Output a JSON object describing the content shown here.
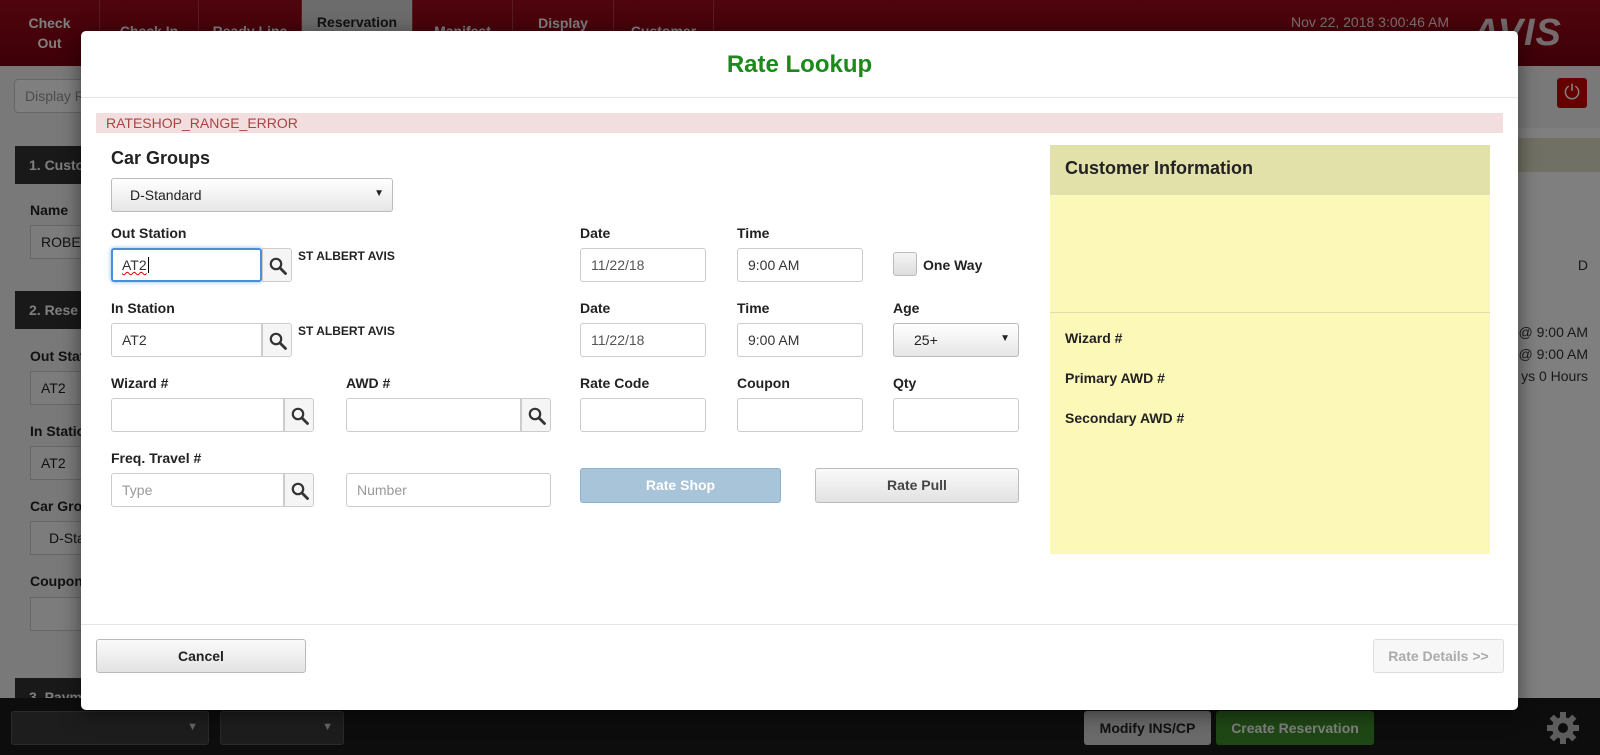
{
  "app": {
    "nav": [
      {
        "label": "Check Out"
      },
      {
        "label": "Check In"
      },
      {
        "label": "Ready Line"
      },
      {
        "label": "Reservation"
      },
      {
        "label": "Manifest"
      },
      {
        "label": "Display"
      },
      {
        "label": "Customer"
      }
    ],
    "datetime": "Nov 22, 2018 3:00:46 AM",
    "logo": "AVIS",
    "display_placeholder": "Display R",
    "sections": {
      "s1": "1. Custo",
      "s2": "2. Rese",
      "s3": "3. Paym"
    },
    "bg_fields": {
      "name_label": "Name",
      "name_value": "ROBE",
      "out_label": "Out Stat",
      "out_value": "AT2",
      "in_label": "In Statio",
      "in_value": "AT2",
      "car_label": "Car Gro",
      "car_value": "D-Sta",
      "coupon_label": "Coupon"
    },
    "right_texts": {
      "d": "D",
      "t1": "@ 9:00 AM",
      "t2": "@ 9:00 AM",
      "t3": "ys 0 Hours"
    },
    "bottom": {
      "modify_label": "Modify INS/CP",
      "create_label": "Create Reservation"
    }
  },
  "modal": {
    "title": "Rate Lookup",
    "error": "RATESHOP_RANGE_ERROR",
    "car_groups_label": "Car Groups",
    "car_group_value": "D-Standard",
    "out_station_label": "Out Station",
    "out_station_value": "AT2",
    "out_station_name": "ST ALBERT AVIS",
    "in_station_label": "In Station",
    "in_station_value": "AT2",
    "in_station_name": "ST ALBERT AVIS",
    "out_date_label": "Date",
    "out_date_value": "11/22/18",
    "out_time_label": "Time",
    "out_time_value": "9:00 AM",
    "one_way_label": "One Way",
    "in_date_label": "Date",
    "in_date_value": "11/22/18",
    "in_time_label": "Time",
    "in_time_value": "9:00 AM",
    "age_label": "Age",
    "age_value": "25+",
    "wizard_label": "Wizard #",
    "awd_label": "AWD #",
    "rate_code_label": "Rate Code",
    "coupon_label": "Coupon",
    "qty_label": "Qty",
    "freq_travel_label": "Freq. Travel #",
    "type_placeholder": "Type",
    "number_placeholder": "Number",
    "rate_shop_label": "Rate Shop",
    "rate_pull_label": "Rate Pull",
    "customer_info": {
      "title": "Customer Information",
      "wizard_label": "Wizard #",
      "primary_awd_label": "Primary AWD #",
      "secondary_awd_label": "Secondary AWD #"
    },
    "cancel_label": "Cancel",
    "rate_details_label": "Rate Details >>"
  }
}
